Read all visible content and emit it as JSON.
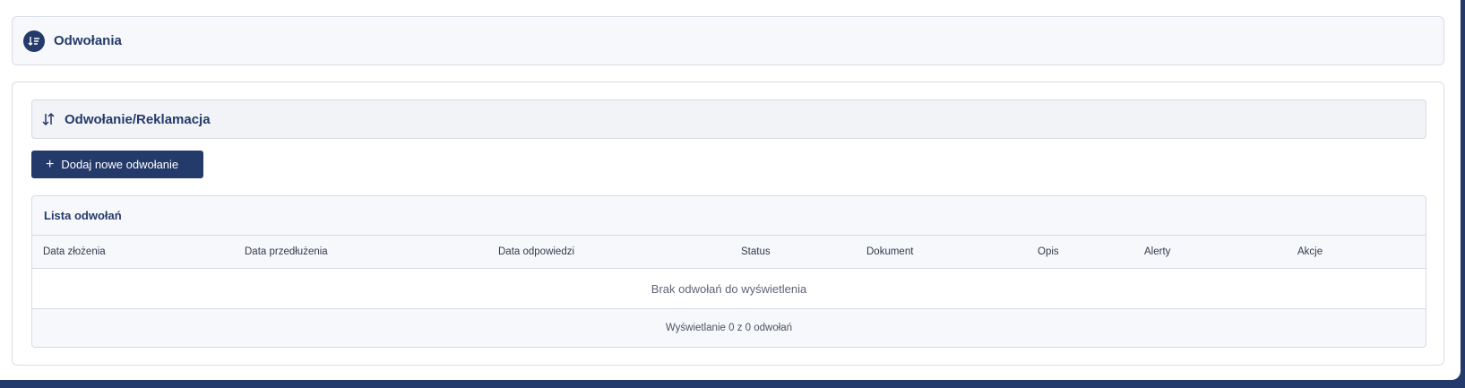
{
  "header": {
    "title": "Odwołania",
    "icon": "sort-list-icon"
  },
  "section": {
    "title": "Odwołanie/Reklamacja",
    "icon": "sort-arrows-icon"
  },
  "add_button": {
    "label": "Dodaj nowe odwołanie",
    "icon": "plus-icon"
  },
  "list": {
    "title": "Lista odwołań",
    "columns": [
      "Data złożenia",
      "Data przedłużenia",
      "Data odpowiedzi",
      "Status",
      "Dokument",
      "Opis",
      "Alerty",
      "Akcje"
    ],
    "empty_message": "Brak odwołań do wyświetlenia",
    "footer": "Wyświetlanie 0 z 0 odwołań"
  },
  "colors": {
    "brand": "#243a6a",
    "panel_bg": "#f7f8fb",
    "border": "#d6dae3"
  }
}
